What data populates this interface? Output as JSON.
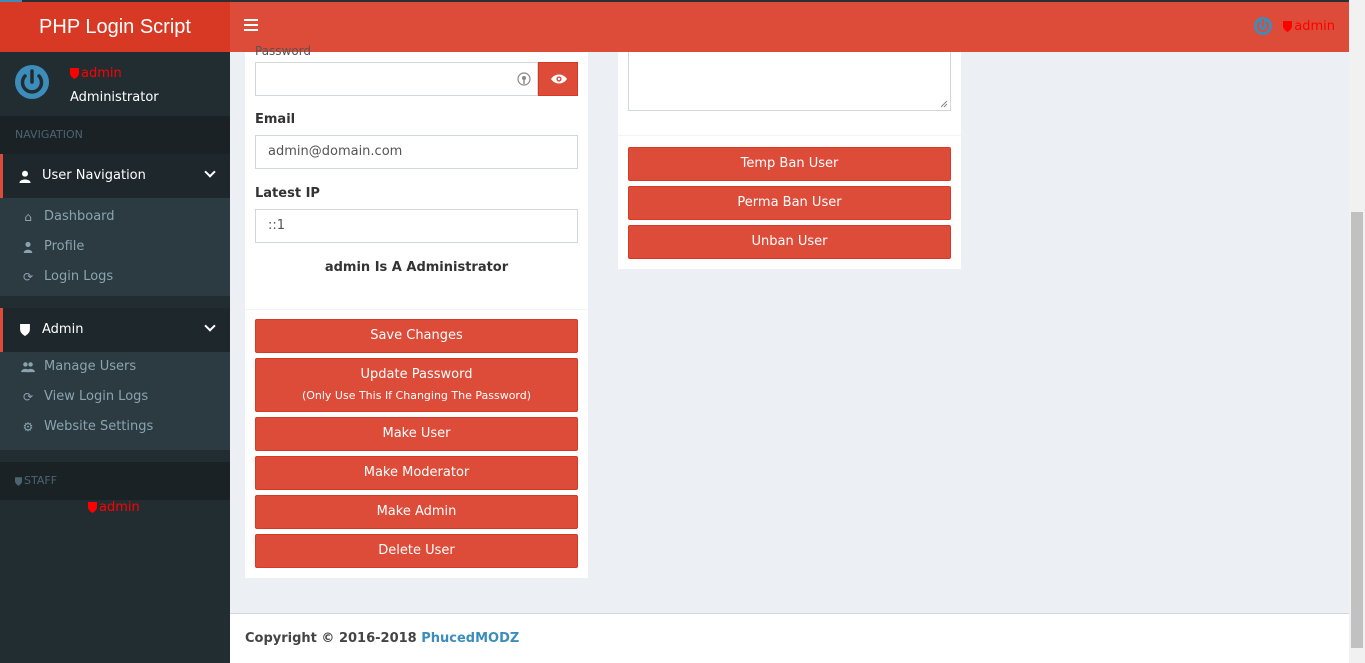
{
  "header": {
    "logo": "PHP Login Script",
    "username": "admin"
  },
  "sidebar": {
    "user": {
      "name": "admin",
      "role": "Administrator"
    },
    "nav_header": "NAVIGATION",
    "user_nav": {
      "title": "User Navigation",
      "items": [
        {
          "label": "Dashboard",
          "icon": "home-icon"
        },
        {
          "label": "Profile",
          "icon": "user-icon"
        },
        {
          "label": "Login Logs",
          "icon": "refresh-icon"
        }
      ]
    },
    "admin_nav": {
      "title": "Admin",
      "items": [
        {
          "label": "Manage Users",
          "icon": "users-icon"
        },
        {
          "label": "View Login Logs",
          "icon": "refresh-icon"
        },
        {
          "label": "Website Settings",
          "icon": "gear-icon"
        }
      ]
    },
    "staff_header": "STAFF",
    "staff_member": "admin"
  },
  "form": {
    "password_label": "Password",
    "password_value": "",
    "email_label": "Email",
    "email_value": "admin@domain.com",
    "ip_label": "Latest IP",
    "ip_value": "::1",
    "role_statement": "admin Is A Administrator"
  },
  "actions": {
    "save": "Save Changes",
    "update_password": "Update Password",
    "update_password_note": "(Only Use This If Changing The Password)",
    "make_user": "Make User",
    "make_moderator": "Make Moderator",
    "make_admin": "Make Admin",
    "delete_user": "Delete User"
  },
  "ban_actions": {
    "temp_ban": "Temp Ban User",
    "perma_ban": "Perma Ban User",
    "unban": "Unban User"
  },
  "footer": {
    "copyright": "Copyright © 2016-2018",
    "brand": "PhucedMODZ"
  },
  "colors": {
    "primary": "#dd4b39",
    "sidebar": "#222d32",
    "link": "#3c8dbc"
  }
}
